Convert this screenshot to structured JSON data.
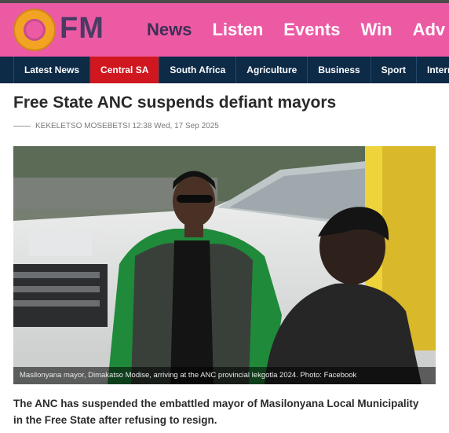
{
  "header": {
    "logo_text": "FM",
    "nav": [
      {
        "label": "News"
      },
      {
        "label": "Listen"
      },
      {
        "label": "Events"
      },
      {
        "label": "Win"
      },
      {
        "label": "Adv"
      }
    ]
  },
  "subnav": {
    "items": [
      {
        "label": "Latest News"
      },
      {
        "label": "Central SA"
      },
      {
        "label": "South Africa"
      },
      {
        "label": "Agriculture"
      },
      {
        "label": "Business"
      },
      {
        "label": "Sport"
      },
      {
        "label": "Interna"
      }
    ]
  },
  "article": {
    "headline": "Free State ANC suspends defiant mayors",
    "byline": "KEKELETSO MOSEBETSI 12:38 Wed, 17 Sep 2025",
    "photo_caption": "Masilonyana mayor, Dimakatso Modise, arriving at the ANC provincial lekgotla 2024. Photo: Facebook",
    "lede": "The ANC has suspended the embattled mayor of Masilonyana Local Municipality in the Free State after refusing to resign."
  },
  "colors": {
    "header_pink": "#ec5aa4",
    "subnav_navy": "#0d2a47",
    "active_red": "#d0161f",
    "logo_orange": "#f3a323"
  }
}
